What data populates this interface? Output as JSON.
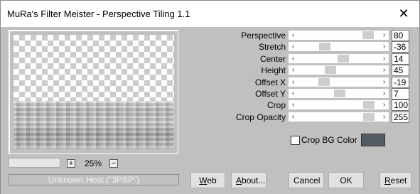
{
  "window": {
    "title": "MuRa's Filter Meister - Perspective Tiling 1.1",
    "close_glyph": "✕"
  },
  "zoom": {
    "plus_label": "+",
    "minus_label": "−",
    "value": "25%"
  },
  "host": {
    "text": "Unknown Host (\"3PSP\")"
  },
  "params": [
    {
      "label": "Perspective",
      "value": "80",
      "slider_fraction": 0.92
    },
    {
      "label": "Stretch",
      "value": "-36",
      "slider_fraction": 0.3
    },
    {
      "label": "Center",
      "value": "14",
      "slider_fraction": 0.57
    },
    {
      "label": "Height",
      "value": "45",
      "slider_fraction": 0.38
    },
    {
      "label": "Offset X",
      "value": "-19",
      "slider_fraction": 0.29
    },
    {
      "label": "Offset Y",
      "value": "7",
      "slider_fraction": 0.52
    },
    {
      "label": "Crop",
      "value": "100",
      "slider_fraction": 0.93
    },
    {
      "label": "Crop Opacity",
      "value": "255",
      "slider_fraction": 0.93
    }
  ],
  "crop_bg": {
    "label": "Crop BG Color",
    "checked": false,
    "color": "#555b63"
  },
  "buttons": {
    "web": {
      "mnemonic": "W",
      "rest": "eb"
    },
    "about": {
      "mnemonic": "A",
      "rest": "bout..."
    },
    "cancel": "Cancel",
    "ok": "OK",
    "reset": {
      "mnemonic": "R",
      "rest": "eset"
    }
  },
  "colors": {
    "dialog_bg": "#c0c0c0",
    "slider_bg": "#ffffff",
    "slider_thumb": "#cdcdcd"
  }
}
